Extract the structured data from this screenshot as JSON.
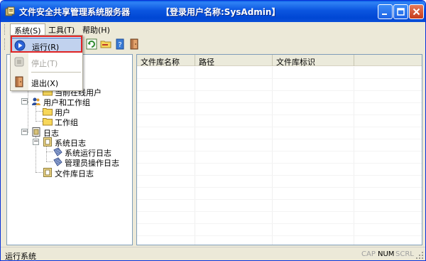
{
  "window": {
    "title": "文件安全共享管理系统服务器",
    "user_label": "【登录用户名称:SysAdmin】"
  },
  "menubar": {
    "items": [
      {
        "label": "系统(S)"
      },
      {
        "label": "工具(T)"
      },
      {
        "label": "帮助(H)"
      }
    ]
  },
  "dropdown": {
    "items": [
      {
        "label": "运行(R)",
        "icon": "play-icon",
        "enabled": true
      },
      {
        "label": "停止(T)",
        "icon": "stop-icon",
        "enabled": false
      },
      {
        "label": "退出(X)",
        "icon": "exit-door-icon",
        "enabled": true
      }
    ]
  },
  "tree": {
    "nodes": [
      {
        "label": "当前在线用户",
        "icon": "folder-icon"
      },
      {
        "label": "用户和工作组",
        "icon": "users-icon"
      },
      {
        "label": "用户",
        "icon": "folder-icon"
      },
      {
        "label": "工作组",
        "icon": "folder-icon"
      },
      {
        "label": "日志",
        "icon": "log-icon"
      },
      {
        "label": "系统日志",
        "icon": "log-book-icon"
      },
      {
        "label": "系统运行日志",
        "icon": "log-entry-icon"
      },
      {
        "label": "管理员操作日志",
        "icon": "log-entry-icon"
      },
      {
        "label": "文件库日志",
        "icon": "log-book-icon"
      }
    ]
  },
  "list": {
    "columns": [
      {
        "label": "文件库名称"
      },
      {
        "label": "路径"
      },
      {
        "label": "文件库标识"
      }
    ],
    "rows": []
  },
  "statusbar": {
    "text": "运行系统",
    "caps": "CAP",
    "num": "NUM",
    "scrl": "SCRL"
  },
  "colors": {
    "titlebar": "#0b56e0",
    "highlight_border": "#e02424",
    "menu_selection": "#c1d2ee"
  }
}
